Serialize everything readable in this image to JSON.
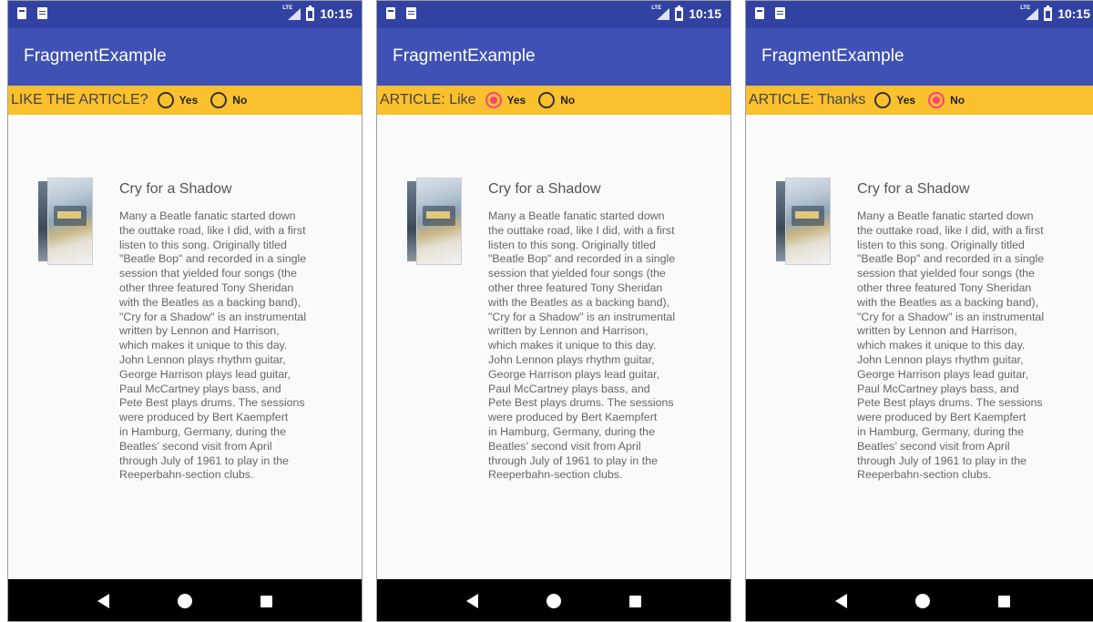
{
  "status": {
    "time": "10:15",
    "network": "LTE"
  },
  "app": {
    "title": "FragmentExample"
  },
  "screens": [
    {
      "rate_label": "LIKE THE ARTICLE?",
      "selected": "none"
    },
    {
      "rate_label": "ARTICLE: Like",
      "selected": "yes"
    },
    {
      "rate_label": "ARTICLE: Thanks",
      "selected": "no"
    }
  ],
  "radio": {
    "yes": "Yes",
    "no": "No"
  },
  "article": {
    "title": "Cry for a Shadow",
    "body": "Many a Beatle fanatic started down\nthe outtake road, like I did, with a first\nlisten to this song. Originally titled\n\"Beatle Bop\" and recorded in a single\nsession that yielded four songs (the\nother three featured Tony Sheridan\nwith the Beatles as a backing band),\n\"Cry for a Shadow\" is an instrumental\nwritten by Lennon and Harrison,\nwhich makes it unique to this day.\nJohn Lennon plays rhythm guitar,\nGeorge Harrison plays lead guitar,\nPaul McCartney plays bass, and\nPete Best plays drums. The sessions\nwere produced by Bert Kaempfert\nin Hamburg, Germany, during the\nBeatles’ second visit from April\nthrough July of 1961 to play in the\nReeperbahn-section clubs."
  },
  "colors": {
    "status_bar": "#3142a2",
    "app_bar": "#3f51b5",
    "rate_bar": "#fbc02d",
    "radio_checked": "#ff4081",
    "nav_bar": "#000000"
  },
  "icons": {
    "status_left": [
      "sd-card-icon",
      "notification-icon"
    ],
    "status_right": [
      "lte-signal-icon",
      "battery-icon"
    ],
    "nav": [
      "back-icon",
      "home-icon",
      "recents-icon"
    ]
  }
}
